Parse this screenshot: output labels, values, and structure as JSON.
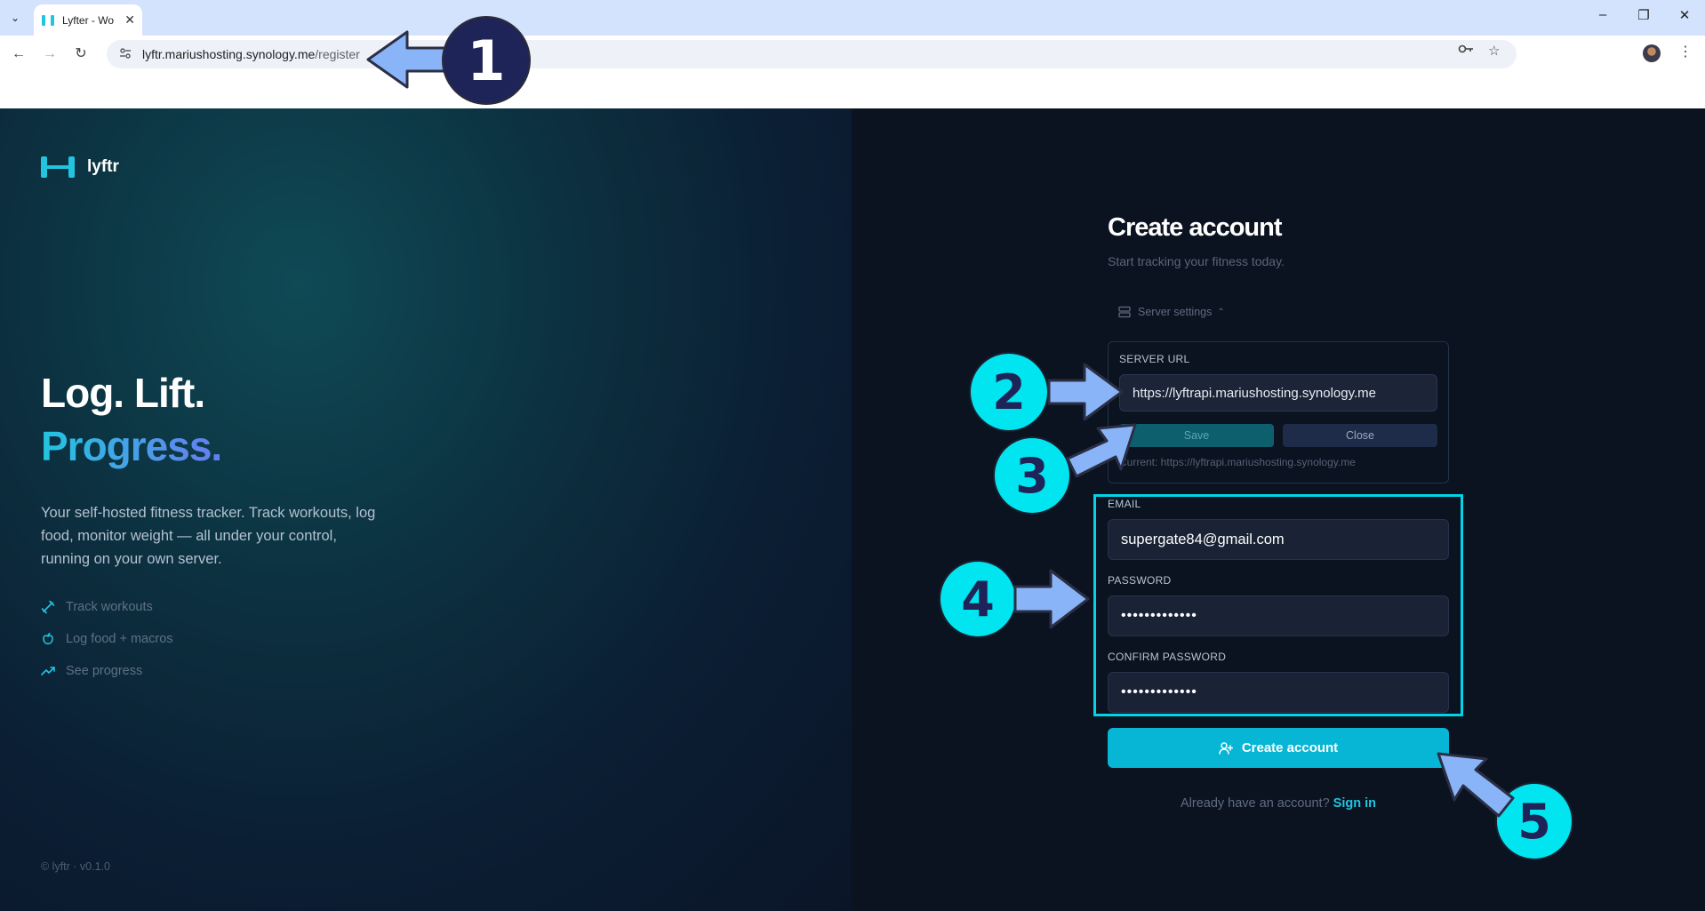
{
  "browser": {
    "tab_title": "Lyfter - Wo",
    "tab_close": "✕",
    "url_host": "lyftr.mariushosting.synology.me",
    "url_path": "/register",
    "window_controls": [
      "–",
      "❐",
      "✕"
    ]
  },
  "brand": {
    "name": "lyftr"
  },
  "hero": {
    "line1": "Log. Lift.",
    "line2": "Progress."
  },
  "description": "Your self-hosted fitness tracker. Track workouts, log food, monitor weight — all under your control, running on your own server.",
  "features": [
    {
      "label": "Track workouts",
      "icon": "dumbbell-icon"
    },
    {
      "label": "Log food + macros",
      "icon": "apple-icon"
    },
    {
      "label": "See progress",
      "icon": "trending-up-icon"
    }
  ],
  "copyright": "© lyftr · v0.1.0",
  "form": {
    "title": "Create account",
    "subtitle": "Start tracking your fitness today.",
    "server_settings_label": "Server settings",
    "server_url_label": "SERVER URL",
    "server_url_value": "https://lyftrapi.mariushosting.synology.me",
    "save_label": "Save",
    "close_label": "Close",
    "current_server": "Current: https://lyftrapi.mariushosting.synology.me",
    "email_label": "EMAIL",
    "email_value": "supergate84@gmail.com",
    "password_label": "PASSWORD",
    "password_value": "•••••••••••••",
    "confirm_label": "CONFIRM PASSWORD",
    "confirm_value": "•••••••••••••",
    "submit_label": "Create account",
    "signin_prompt": "Already have an account?",
    "signin_link": "Sign in"
  },
  "annotations": [
    "1",
    "2",
    "3",
    "4",
    "5"
  ],
  "colors": {
    "accent": "#06b6d4",
    "badge_cyan": "#00e5f0",
    "badge_dark": "#1e2457",
    "arrow": "#8ab4f8"
  }
}
